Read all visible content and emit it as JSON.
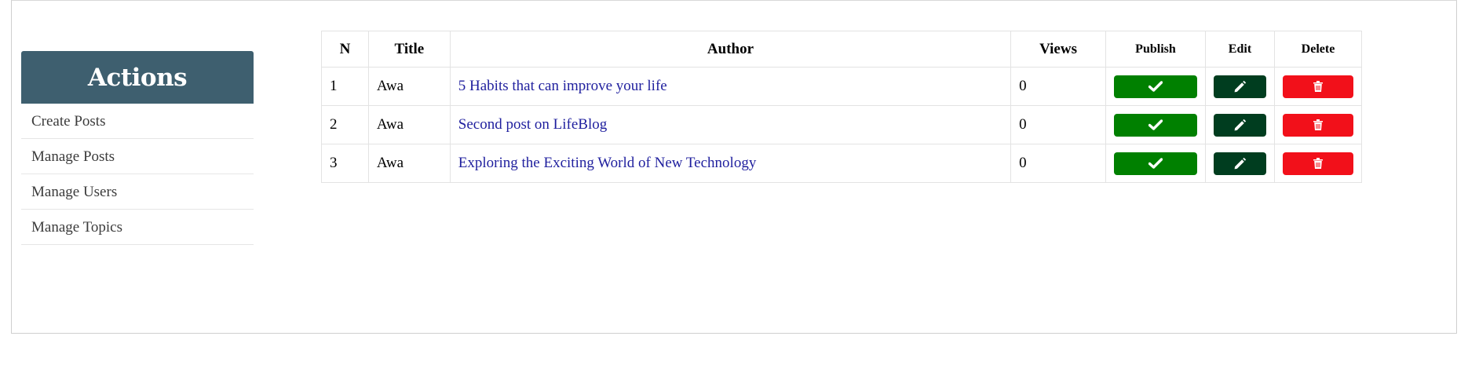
{
  "sidebar": {
    "title": "Actions",
    "items": [
      {
        "label": "Create Posts"
      },
      {
        "label": "Manage Posts"
      },
      {
        "label": "Manage Users"
      },
      {
        "label": "Manage Topics"
      }
    ]
  },
  "table": {
    "headers": {
      "n": "N",
      "title": "Title",
      "author": "Author",
      "views": "Views",
      "publish": "Publish",
      "edit": "Edit",
      "delete": "Delete"
    },
    "rows": [
      {
        "n": "1",
        "title": "Awa",
        "author": "5 Habits that can improve your life",
        "views": "0"
      },
      {
        "n": "2",
        "title": "Awa",
        "author": "Second post on LifeBlog",
        "views": "0"
      },
      {
        "n": "3",
        "title": "Awa",
        "author": "Exploring the Exciting World of New Technology",
        "views": "0"
      }
    ]
  },
  "icons": {
    "publish": "check-icon",
    "edit": "pencil-icon",
    "delete": "trash-icon"
  },
  "colors": {
    "sidebar_header": "#3e5f6f",
    "publish": "#008000",
    "edit": "#003d1f",
    "delete": "#f2101a",
    "link": "#1f1f9e"
  }
}
